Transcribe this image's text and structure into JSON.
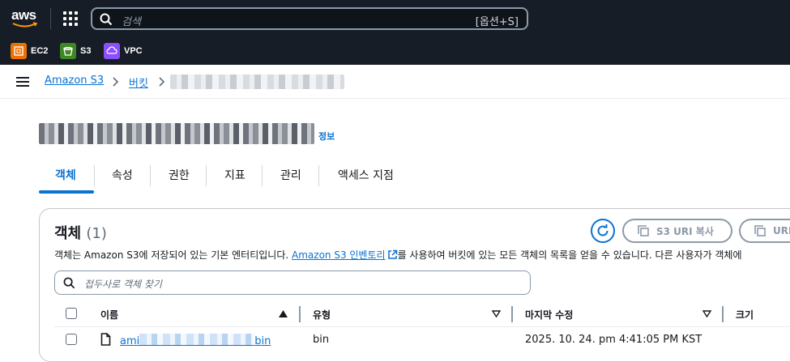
{
  "topbar": {
    "logo_text": "aws",
    "search_placeholder": "검색",
    "search_shortcut": "[옵션+S]"
  },
  "favorites": [
    {
      "label": "EC2",
      "color": "#ed7100"
    },
    {
      "label": "S3",
      "color": "#3f8624"
    },
    {
      "label": "VPC",
      "color": "#8c4fff"
    }
  ],
  "breadcrumb": {
    "items": [
      "Amazon S3",
      "버킷"
    ]
  },
  "page": {
    "info_label": "정보"
  },
  "tabs": [
    "객체",
    "속성",
    "권한",
    "지표",
    "관리",
    "액세스 지점"
  ],
  "objects_panel": {
    "title": "객체",
    "count": "(1)",
    "copy_uri_label": "S3 URI 복사",
    "copy_url_label": "URI",
    "description_before": "객체는 Amazon S3에 저장되어 있는 기본 엔터티입니다.",
    "description_link": "Amazon S3 인벤토리",
    "description_after": "를 사용하여 버킷에 있는 모든 객체의 목록을 얻을 수 있습니다. 다른 사용자가 객체에",
    "filter_placeholder": "접두사로 객체 찾기"
  },
  "table": {
    "headers": [
      "이름",
      "유형",
      "마지막 수정",
      "크기"
    ],
    "rows": [
      {
        "name_start": "ami",
        "name_end": "bin",
        "type": "bin",
        "modified": "2025. 10. 24. pm 4:41:05 PM KST"
      }
    ]
  },
  "colors": {
    "accent": "#0972d3",
    "topbar": "#161d26"
  }
}
